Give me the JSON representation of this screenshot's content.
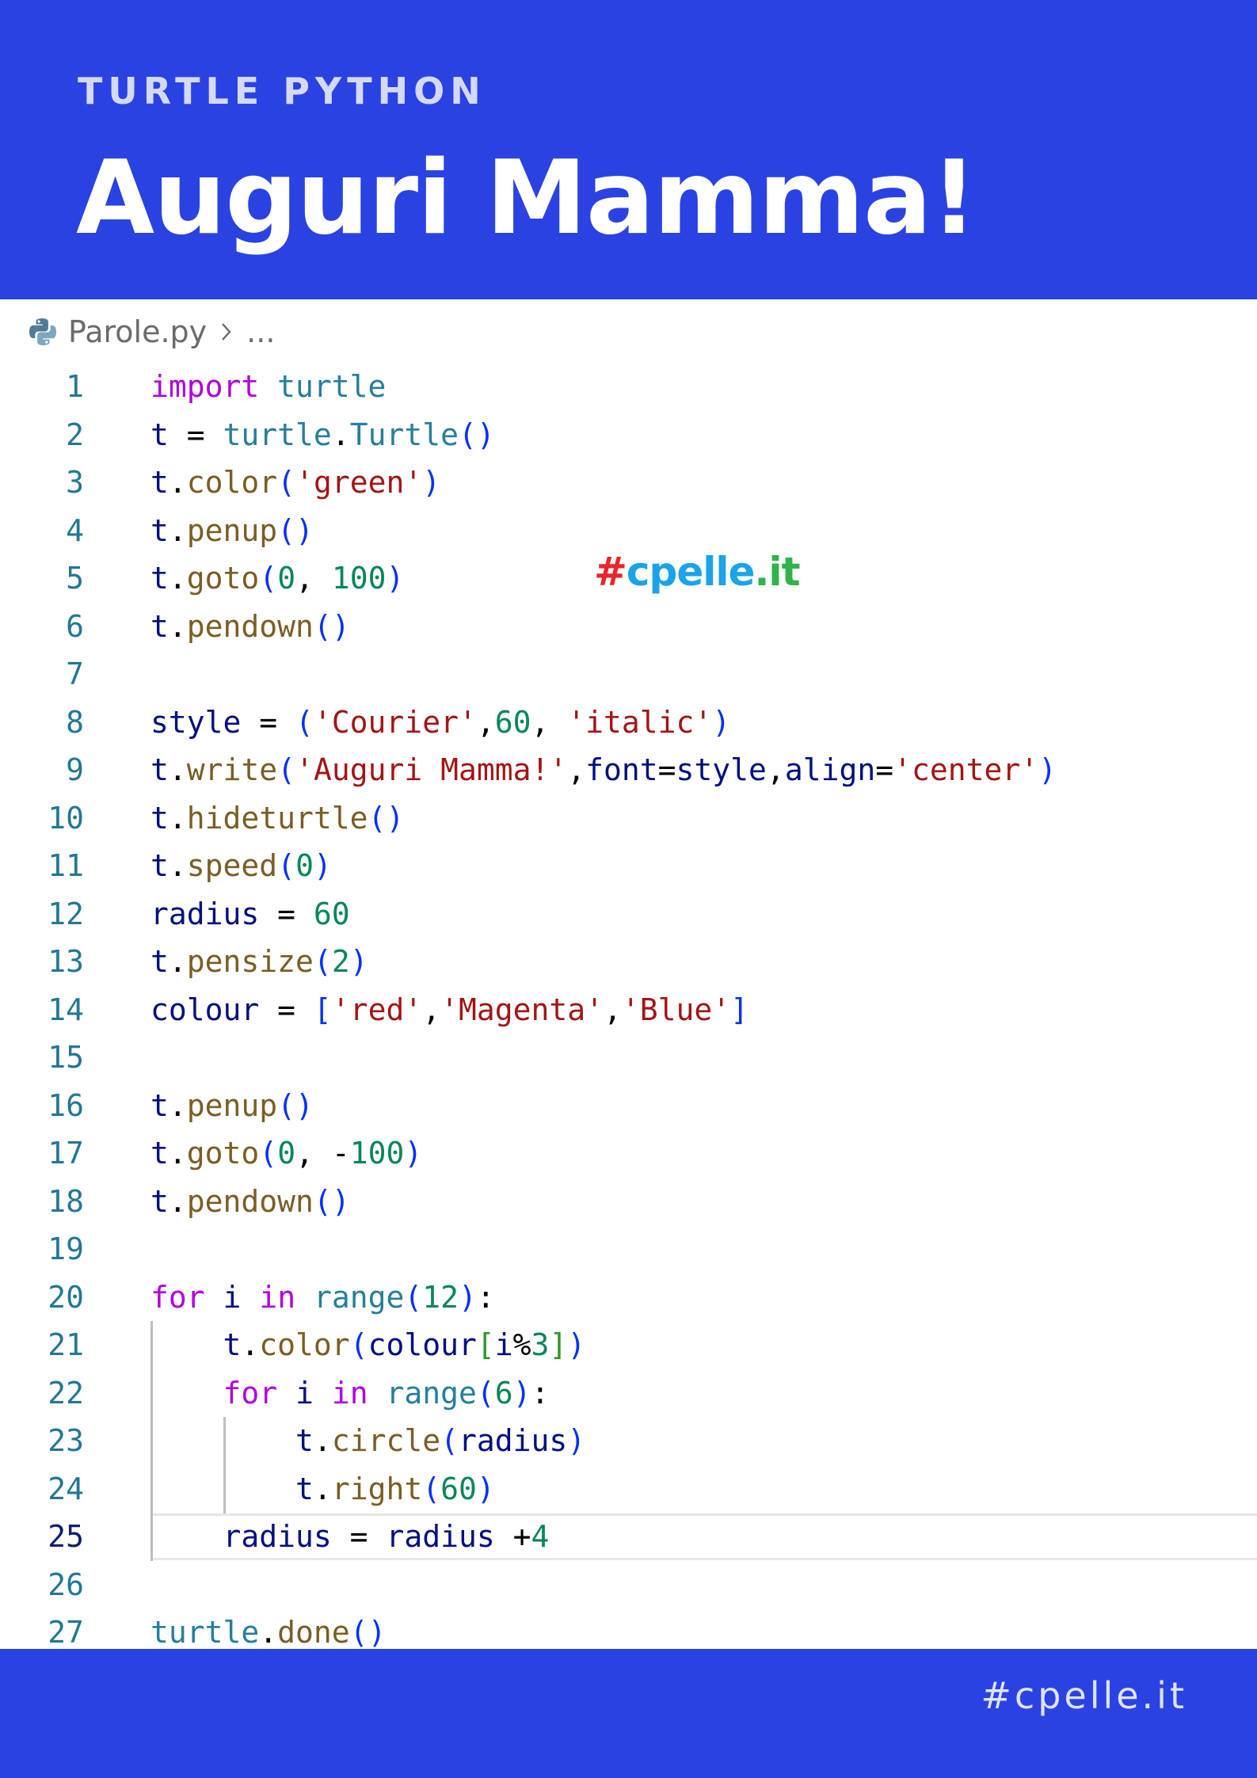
{
  "header": {
    "subtitle": "TURTLE PYTHON",
    "title": "Auguri Mamma!"
  },
  "breadcrumb": {
    "icon": "python-file-icon",
    "filename": "Parole.py",
    "ellipsis": "..."
  },
  "watermark": {
    "hash": "#",
    "name": "cpelle",
    "tld": ".it"
  },
  "colors": {
    "brand_blue": "#2b42e3",
    "keyword": "#af00db",
    "module": "#267f99",
    "function": "#795e26",
    "string": "#a31515",
    "number": "#098658",
    "variable": "#001080",
    "line_number": "#237893"
  },
  "editor": {
    "current_line": 25,
    "lines": [
      {
        "n": "1",
        "tokens": [
          [
            "kw",
            "import"
          ],
          [
            "op",
            " "
          ],
          [
            "mod",
            "turtle"
          ]
        ]
      },
      {
        "n": "2",
        "tokens": [
          [
            "var",
            "t"
          ],
          [
            "op",
            " = "
          ],
          [
            "mod",
            "turtle"
          ],
          [
            "op",
            "."
          ],
          [
            "mod",
            "Turtle"
          ],
          [
            "br1",
            "()"
          ]
        ]
      },
      {
        "n": "3",
        "tokens": [
          [
            "var",
            "t"
          ],
          [
            "op",
            "."
          ],
          [
            "fn",
            "color"
          ],
          [
            "br1",
            "("
          ],
          [
            "str",
            "'green'"
          ],
          [
            "br1",
            ")"
          ]
        ]
      },
      {
        "n": "4",
        "tokens": [
          [
            "var",
            "t"
          ],
          [
            "op",
            "."
          ],
          [
            "fn",
            "penup"
          ],
          [
            "br1",
            "()"
          ]
        ]
      },
      {
        "n": "5",
        "tokens": [
          [
            "var",
            "t"
          ],
          [
            "op",
            "."
          ],
          [
            "fn",
            "goto"
          ],
          [
            "br1",
            "("
          ],
          [
            "num",
            "0"
          ],
          [
            "op",
            ", "
          ],
          [
            "num",
            "100"
          ],
          [
            "br1",
            ")"
          ]
        ]
      },
      {
        "n": "6",
        "tokens": [
          [
            "var",
            "t"
          ],
          [
            "op",
            "."
          ],
          [
            "fn",
            "pendown"
          ],
          [
            "br1",
            "()"
          ]
        ]
      },
      {
        "n": "7",
        "tokens": []
      },
      {
        "n": "8",
        "tokens": [
          [
            "var",
            "style"
          ],
          [
            "op",
            " = "
          ],
          [
            "br1",
            "("
          ],
          [
            "str",
            "'Courier'"
          ],
          [
            "op",
            ","
          ],
          [
            "num",
            "60"
          ],
          [
            "op",
            ", "
          ],
          [
            "str",
            "'italic'"
          ],
          [
            "br1",
            ")"
          ]
        ]
      },
      {
        "n": "9",
        "tokens": [
          [
            "var",
            "t"
          ],
          [
            "op",
            "."
          ],
          [
            "fn",
            "write"
          ],
          [
            "br1",
            "("
          ],
          [
            "str",
            "'Auguri Mamma!'"
          ],
          [
            "op",
            ","
          ],
          [
            "var",
            "font"
          ],
          [
            "op",
            "="
          ],
          [
            "var",
            "style"
          ],
          [
            "op",
            ","
          ],
          [
            "var",
            "align"
          ],
          [
            "op",
            "="
          ],
          [
            "str",
            "'center'"
          ],
          [
            "br1",
            ")"
          ]
        ]
      },
      {
        "n": "10",
        "tokens": [
          [
            "var",
            "t"
          ],
          [
            "op",
            "."
          ],
          [
            "fn",
            "hideturtle"
          ],
          [
            "br1",
            "()"
          ]
        ]
      },
      {
        "n": "11",
        "tokens": [
          [
            "var",
            "t"
          ],
          [
            "op",
            "."
          ],
          [
            "fn",
            "speed"
          ],
          [
            "br1",
            "("
          ],
          [
            "num",
            "0"
          ],
          [
            "br1",
            ")"
          ]
        ]
      },
      {
        "n": "12",
        "tokens": [
          [
            "var",
            "radius"
          ],
          [
            "op",
            " = "
          ],
          [
            "num",
            "60"
          ]
        ]
      },
      {
        "n": "13",
        "tokens": [
          [
            "var",
            "t"
          ],
          [
            "op",
            "."
          ],
          [
            "fn",
            "pensize"
          ],
          [
            "br1",
            "("
          ],
          [
            "num",
            "2"
          ],
          [
            "br1",
            ")"
          ]
        ]
      },
      {
        "n": "14",
        "tokens": [
          [
            "var",
            "colour"
          ],
          [
            "op",
            " = "
          ],
          [
            "br1",
            "["
          ],
          [
            "str",
            "'red'"
          ],
          [
            "op",
            ","
          ],
          [
            "str",
            "'Magenta'"
          ],
          [
            "op",
            ","
          ],
          [
            "str",
            "'Blue'"
          ],
          [
            "br1",
            "]"
          ]
        ]
      },
      {
        "n": "15",
        "tokens": []
      },
      {
        "n": "16",
        "tokens": [
          [
            "var",
            "t"
          ],
          [
            "op",
            "."
          ],
          [
            "fn",
            "penup"
          ],
          [
            "br1",
            "()"
          ]
        ]
      },
      {
        "n": "17",
        "tokens": [
          [
            "var",
            "t"
          ],
          [
            "op",
            "."
          ],
          [
            "fn",
            "goto"
          ],
          [
            "br1",
            "("
          ],
          [
            "num",
            "0"
          ],
          [
            "op",
            ", -"
          ],
          [
            "num",
            "100"
          ],
          [
            "br1",
            ")"
          ]
        ]
      },
      {
        "n": "18",
        "tokens": [
          [
            "var",
            "t"
          ],
          [
            "op",
            "."
          ],
          [
            "fn",
            "pendown"
          ],
          [
            "br1",
            "()"
          ]
        ]
      },
      {
        "n": "19",
        "tokens": []
      },
      {
        "n": "20",
        "tokens": [
          [
            "kw",
            "for"
          ],
          [
            "op",
            " "
          ],
          [
            "var",
            "i"
          ],
          [
            "op",
            " "
          ],
          [
            "kw",
            "in"
          ],
          [
            "op",
            " "
          ],
          [
            "mod",
            "range"
          ],
          [
            "br1",
            "("
          ],
          [
            "num",
            "12"
          ],
          [
            "br1",
            ")"
          ],
          [
            "op",
            ":"
          ]
        ]
      },
      {
        "n": "21",
        "tokens": [
          [
            "op",
            "    "
          ],
          [
            "var",
            "t"
          ],
          [
            "op",
            "."
          ],
          [
            "fn",
            "color"
          ],
          [
            "br1",
            "("
          ],
          [
            "var",
            "colour"
          ],
          [
            "br2",
            "["
          ],
          [
            "var",
            "i"
          ],
          [
            "op",
            "%"
          ],
          [
            "num",
            "3"
          ],
          [
            "br2",
            "]"
          ],
          [
            "br1",
            ")"
          ]
        ]
      },
      {
        "n": "22",
        "tokens": [
          [
            "op",
            "    "
          ],
          [
            "kw",
            "for"
          ],
          [
            "op",
            " "
          ],
          [
            "var",
            "i"
          ],
          [
            "op",
            " "
          ],
          [
            "kw",
            "in"
          ],
          [
            "op",
            " "
          ],
          [
            "mod",
            "range"
          ],
          [
            "br1",
            "("
          ],
          [
            "num",
            "6"
          ],
          [
            "br1",
            ")"
          ],
          [
            "op",
            ":"
          ]
        ]
      },
      {
        "n": "23",
        "tokens": [
          [
            "op",
            "        "
          ],
          [
            "var",
            "t"
          ],
          [
            "op",
            "."
          ],
          [
            "fn",
            "circle"
          ],
          [
            "br1",
            "("
          ],
          [
            "var",
            "radius"
          ],
          [
            "br1",
            ")"
          ]
        ]
      },
      {
        "n": "24",
        "tokens": [
          [
            "op",
            "        "
          ],
          [
            "var",
            "t"
          ],
          [
            "op",
            "."
          ],
          [
            "fn",
            "right"
          ],
          [
            "br1",
            "("
          ],
          [
            "num",
            "60"
          ],
          [
            "br1",
            ")"
          ]
        ]
      },
      {
        "n": "25",
        "tokens": [
          [
            "op",
            "    "
          ],
          [
            "var",
            "radius"
          ],
          [
            "op",
            " = "
          ],
          [
            "var",
            "radius"
          ],
          [
            "op",
            " +"
          ],
          [
            "num",
            "4"
          ]
        ]
      },
      {
        "n": "26",
        "tokens": []
      },
      {
        "n": "27",
        "tokens": [
          [
            "mod",
            "turtle"
          ],
          [
            "op",
            "."
          ],
          [
            "fn",
            "done"
          ],
          [
            "br1",
            "()"
          ]
        ]
      }
    ]
  },
  "footer": {
    "text": "#cpelle.it"
  }
}
